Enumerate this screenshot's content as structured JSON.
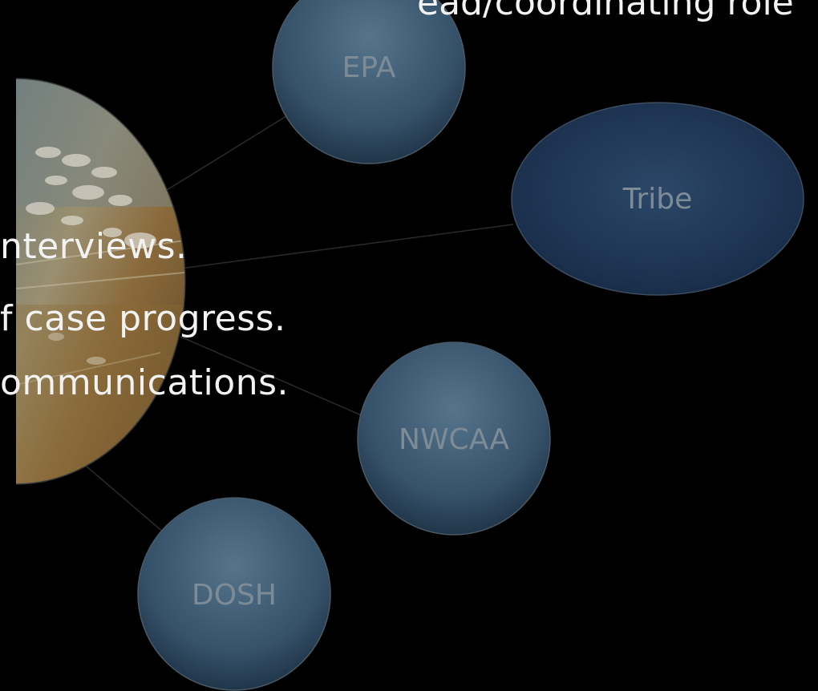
{
  "slide": {
    "heading_fragment": "ead/coordinating role",
    "bullets": [
      "nterviews.",
      "f case progress.",
      "ommunications."
    ]
  },
  "nodes": {
    "epa": "EPA",
    "tribe": "Tribe",
    "nwcaa": "NWCAA",
    "dosh": "DOSH"
  },
  "colors": {
    "background": "#000000",
    "text": "#f2f2f2",
    "node_fill": "#4a6578",
    "node_label": "#7d8b96",
    "connector": "#2a2a2a"
  },
  "icons": {
    "center_image": "refinery-photo"
  }
}
